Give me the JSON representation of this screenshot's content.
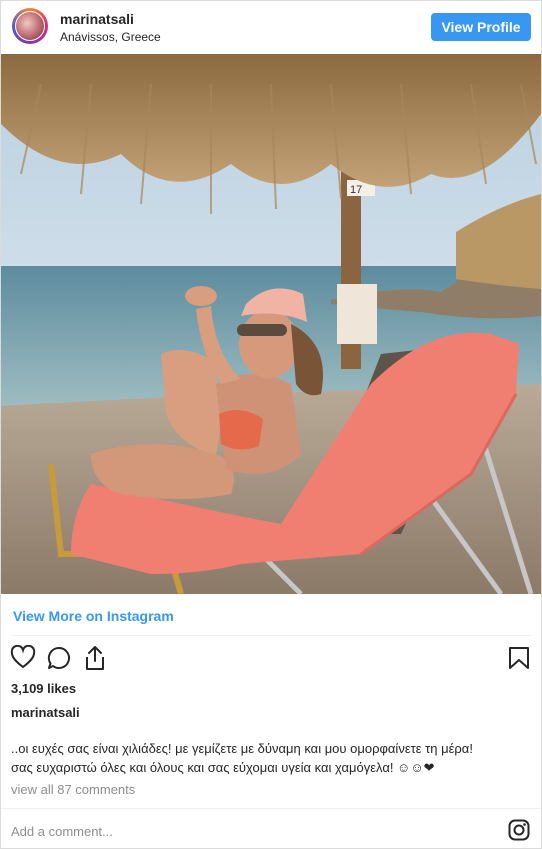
{
  "header": {
    "username": "marinatsali",
    "location": "Anávissos, Greece",
    "view_profile_label": "View Profile"
  },
  "photo": {
    "umbrella_tag": "17"
  },
  "view_more_label": "View More on Instagram",
  "actions": {
    "icons": [
      "heart-icon",
      "comment-icon",
      "share-icon",
      "bookmark-icon"
    ]
  },
  "likes": "3,109 likes",
  "caption": {
    "username": "marinatsali",
    "line1": "..οι ευχές σας είναι χιλιάδες! με γεμίζετε με δύναμη και μου ομορφαίνετε τη μέρα!",
    "line2": "σας ευχαριστώ όλες και όλους και σας εύχομαι υγεία και χαμόγελα! ☺☺❤"
  },
  "view_all_comments": "view all 87 comments",
  "add_comment_placeholder": "Add a comment...",
  "colors": {
    "accent": "#3897f0",
    "text": "#262626",
    "muted": "#8e8e8e",
    "border": "#dbdbdb"
  }
}
